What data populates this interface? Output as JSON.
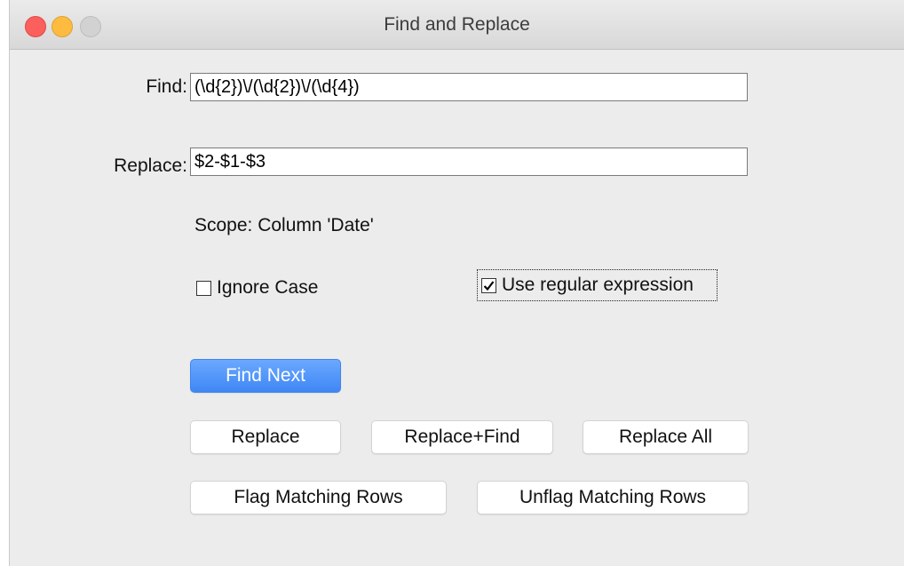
{
  "window": {
    "title": "Find and Replace"
  },
  "form": {
    "find_label": "Find:",
    "find_value": "(\\d{2})\\/(\\d{2})\\/(\\d{4})",
    "replace_label": "Replace:",
    "replace_value": "$2-$1-$3",
    "scope_text": "Scope: Column 'Date'",
    "ignore_case_label": "Ignore Case",
    "ignore_case_checked": false,
    "use_regex_label": "Use regular expression",
    "use_regex_checked": true
  },
  "buttons": {
    "find_next": "Find Next",
    "replace": "Replace",
    "replace_find": "Replace+Find",
    "replace_all": "Replace All",
    "flag_matching": "Flag Matching Rows",
    "unflag_matching": "Unflag Matching Rows"
  },
  "colors": {
    "primary_button": "#4a8ff8",
    "close_button": "#fc605c",
    "minimize_button": "#fdbc40",
    "zoom_button": "#d2d2d2"
  }
}
